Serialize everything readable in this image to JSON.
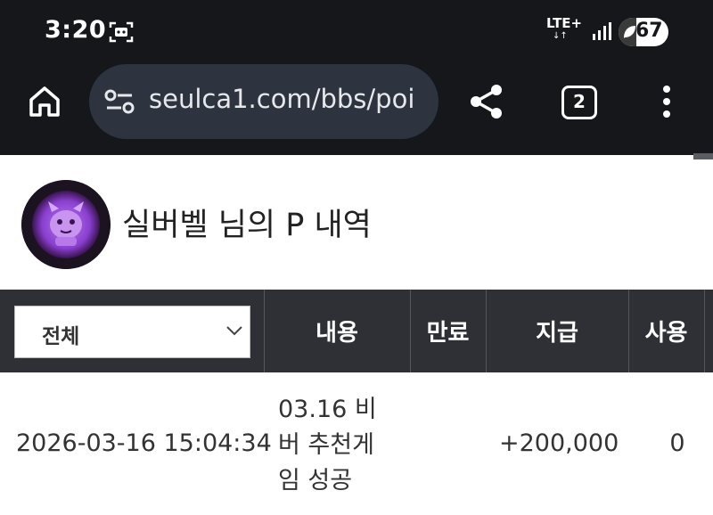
{
  "status_bar": {
    "time": "3:20",
    "network": "LTE+",
    "network_arrows": "↓↑",
    "battery": "67",
    "icons": [
      "screenshot-icon",
      "signal-icon",
      "battery-saver-icon"
    ]
  },
  "browser": {
    "url": "seulca1.com/bbs/poi",
    "tab_count": "2",
    "icons": [
      "home-icon",
      "site-settings-icon",
      "share-icon",
      "tabs-icon",
      "more-menu-icon"
    ]
  },
  "profile": {
    "title": "실버벨 님의 P 내역"
  },
  "table": {
    "filter": {
      "selected": "전체"
    },
    "headers": {
      "content": "내용",
      "expire": "만료",
      "paid": "지급",
      "used": "사용"
    },
    "rows": [
      {
        "date": "2026-03-16 15:04:34",
        "content_lines": [
          "03.16 비",
          "버 추천게",
          "임 성공"
        ],
        "paid": "+200,000",
        "used": "0"
      }
    ]
  },
  "colors": {
    "top_bar": "#15171b",
    "url_box": "#2d3440",
    "table_header": "#2f3035",
    "avatar_accent": "#9b55d8"
  }
}
